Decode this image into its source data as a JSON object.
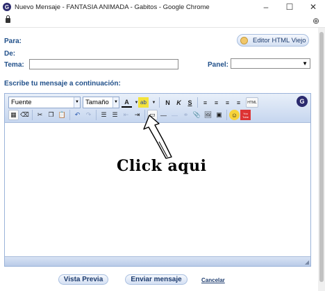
{
  "window": {
    "title": "Nuevo Mensaje - FANTASIA ANIMADA - Gabitos - Google Chrome",
    "app_icon_letter": "G",
    "minimize": "–",
    "maximize": "☐",
    "close": "✕"
  },
  "form": {
    "para_label": "Para:",
    "de_label": "De:",
    "tema_label": "Tema:",
    "tema_value": "",
    "panel_label": "Panel:",
    "panel_value": "",
    "editor_html_button": "Editor HTML Viejo",
    "instructions": "Escribe tu mensaje a continuación:"
  },
  "toolbar": {
    "font_value": "Fuente",
    "size_value": "Tamaño",
    "bold": "N",
    "italic": "K",
    "underline": "S",
    "html_button": "HTML",
    "g_button": "G",
    "youtube_label": "You Tube"
  },
  "annotation": {
    "text": "Click aqui"
  },
  "footer": {
    "preview_button": "Vista Previa",
    "send_button": "Enviar mensaje",
    "cancel_link": "Cancelar"
  },
  "colors": {
    "label_blue": "#21508a",
    "toolbar_top": "#e8eff9",
    "toolbar_bottom": "#c6d6ef",
    "brand_navy": "#2b2a6e"
  }
}
